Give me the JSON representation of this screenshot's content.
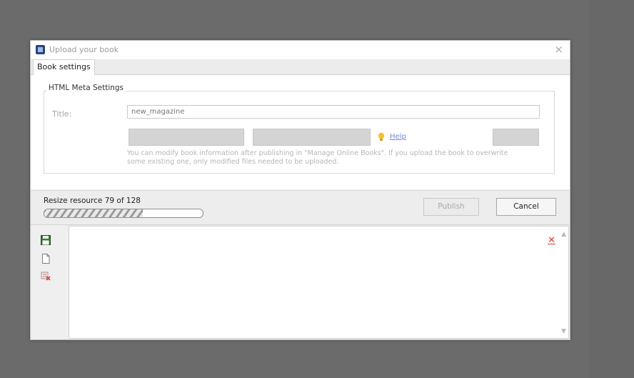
{
  "window": {
    "title": "Upload your book",
    "close_symbol": "×"
  },
  "tabs": [
    {
      "label": "Book settings",
      "active": true
    }
  ],
  "meta_settings": {
    "legend": "HTML Meta Settings",
    "title_label": "Title:",
    "title_value": "new_magazine",
    "buttons": [
      "",
      "",
      ""
    ],
    "help_link": "Help",
    "info_text": "You can modify book information after publishing in \"Manage Online Books\". If you upload the book to overwrite some existing one, only modified files needed to be uploaded."
  },
  "status": {
    "message": "Resize resource 79 of 128",
    "progress_fraction": 0.62,
    "publish_label": "Publish",
    "cancel_label": "Cancel"
  },
  "log": {
    "toolbar_icons": [
      "save-icon",
      "new-document-icon",
      "delete-log-icon"
    ],
    "clear_icon": "clear-log-icon",
    "clear_symbol": "✕"
  },
  "colors": {
    "background": "#6b6b6b",
    "dialog": "#f1f1f1",
    "help_link": "#6e8ad6",
    "clear_icon": "#d63b2b"
  }
}
